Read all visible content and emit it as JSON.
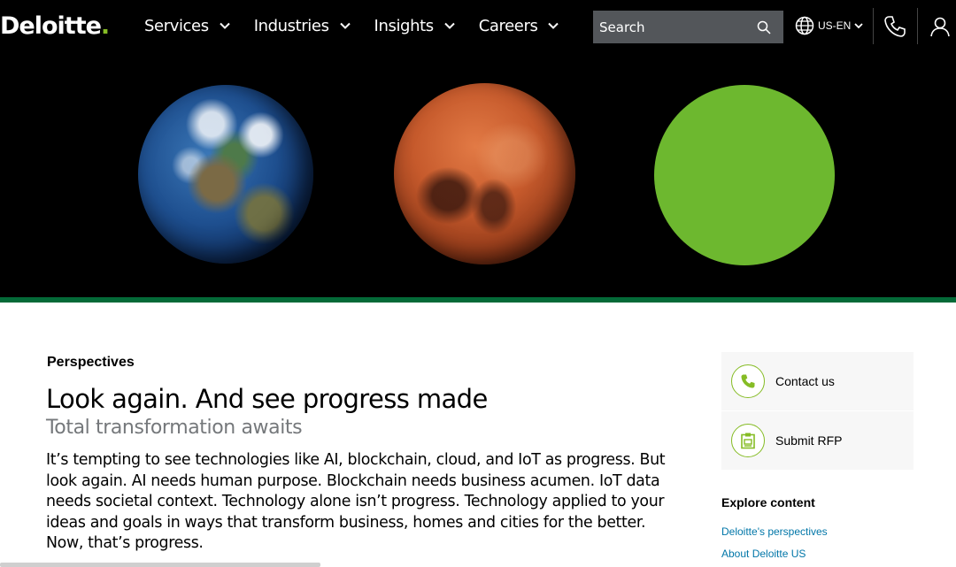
{
  "header": {
    "logo_text": "Deloitte",
    "logo_dot": ".",
    "nav": [
      {
        "label": "Services"
      },
      {
        "label": "Industries"
      },
      {
        "label": "Insights"
      },
      {
        "label": "Careers"
      }
    ],
    "search_placeholder": "Search",
    "locale": "US-EN"
  },
  "hero": {
    "images": [
      "earth",
      "mars",
      "green-circle"
    ],
    "accent_bar_color": "#046a38",
    "green_circle_color": "#6db82f"
  },
  "content": {
    "eyebrow": "Perspectives",
    "title": "Look again. And see progress made",
    "subtitle": "Total transformation awaits",
    "body": "It’s tempting to see technologies like AI, blockchain, cloud, and IoT as progress. But look again. AI needs human purpose. Blockchain needs business acumen. IoT data needs societal context. Technology alone isn’t progress. Technology applied to your ideas and goals in ways that transform business, homes and cities for the better. Now, that’s progress."
  },
  "sidebar": {
    "contact_label": "Contact us",
    "rfp_label": "Submit RFP",
    "explore_title": "Explore content",
    "links": [
      "Deloitte's perspectives",
      "About Deloitte US"
    ]
  },
  "colors": {
    "brand_green": "#86bc25",
    "link_blue": "#0076a8",
    "search_bg": "#53565a"
  }
}
